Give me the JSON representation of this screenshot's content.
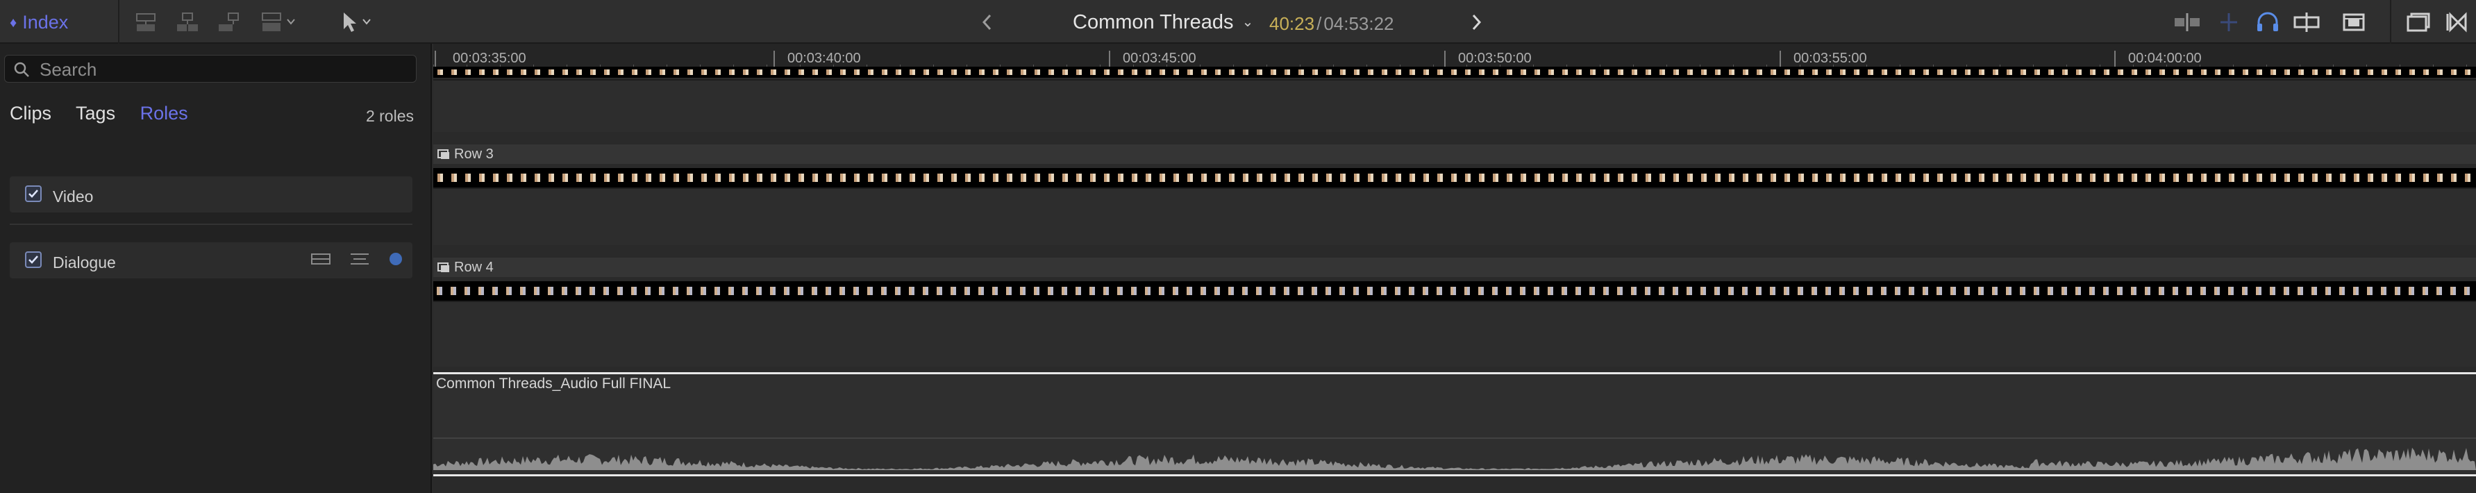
{
  "toolbar": {
    "index_label": "Index",
    "project_title": "Common Threads",
    "timecode_current": "40:23",
    "timecode_separator": "/",
    "timecode_duration": "04:53:22",
    "icons": [
      "clip-connect-icon",
      "clip-insert-icon",
      "clip-append-icon",
      "clip-overwrite-icon",
      "select-arrow-icon",
      "back-icon",
      "forward-icon",
      "skimming-icon",
      "audio-skimming-icon",
      "headphones-icon",
      "snapping-icon",
      "clip-appearance-icon",
      "effects-browser-icon",
      "transitions-browser-icon"
    ]
  },
  "index": {
    "search_placeholder": "Search",
    "tabs": [
      {
        "label": "Clips",
        "active": false
      },
      {
        "label": "Tags",
        "active": false
      },
      {
        "label": "Roles",
        "active": true
      }
    ],
    "roles_count": "2 roles",
    "roles": [
      {
        "label": "Video",
        "checked": true
      },
      {
        "label": "Dialogue",
        "checked": true
      }
    ],
    "accent_color": "#6b72e8"
  },
  "timeline": {
    "ruler_labels": [
      "00:03:35:00",
      "00:03:40:00",
      "00:03:45:00",
      "00:03:50:00",
      "00:03:55:00",
      "00:04:00:00"
    ],
    "rows": [
      {
        "label": "Row 3"
      },
      {
        "label": "Row 4"
      }
    ],
    "audio_clip_title": "Common Threads_Audio Full FINAL"
  }
}
